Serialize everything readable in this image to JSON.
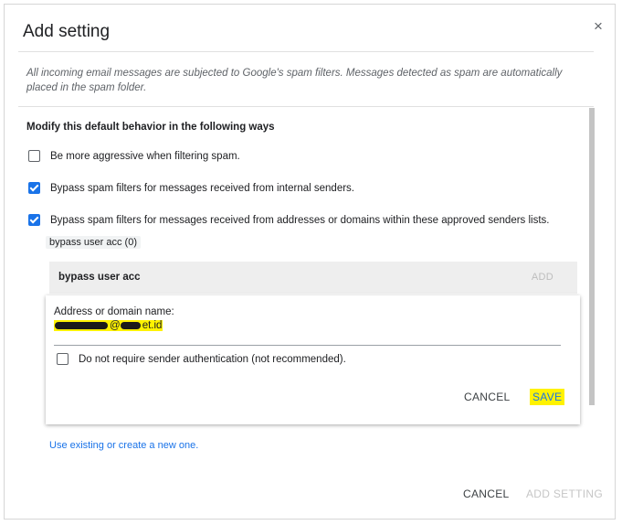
{
  "dialog": {
    "title": "Add setting",
    "close_glyph": "×",
    "description": "All incoming email messages are subjected to Google's spam filters. Messages detected as spam are automatically placed in the spam folder.",
    "section_heading": "Modify this default behavior in the following ways",
    "options": [
      {
        "label": "Be more aggressive when filtering spam.",
        "checked": false
      },
      {
        "label": "Bypass spam filters for messages received from internal senders.",
        "checked": true
      },
      {
        "label": "Bypass spam filters for messages received from addresses or domains within these approved senders lists.",
        "checked": true
      }
    ],
    "chip_label": "bypass user acc (0)",
    "list": {
      "title": "bypass user acc",
      "add_label": "ADD"
    },
    "card": {
      "field_label": "Address or domain name:",
      "field_value_suffix": "@",
      "field_value_domain": "et.id",
      "option_label": "Do not require sender authentication (not recommended).",
      "option_checked": false,
      "cancel_label": "CANCEL",
      "save_label": "SAVE"
    },
    "link_label": "Use existing or create a new one.",
    "footer": {
      "cancel_label": "CANCEL",
      "add_setting_label": "ADD SETTING"
    }
  },
  "colors": {
    "accent": "#1a73e8",
    "highlight": "#fff200"
  },
  "icons": {
    "close": "close-icon",
    "checkbox": "checkbox-icon"
  }
}
